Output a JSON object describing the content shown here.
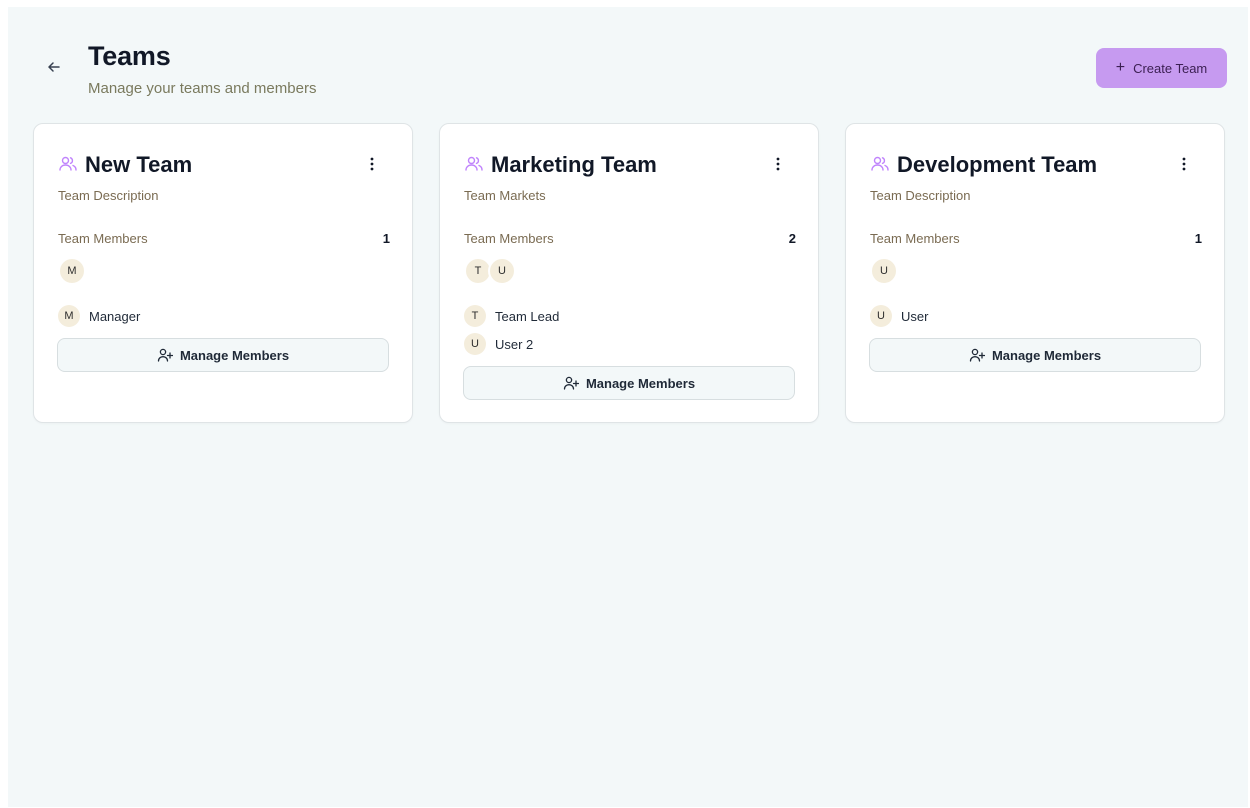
{
  "header": {
    "back_icon": "arrow-left-icon",
    "title": "Teams",
    "subtitle": "Manage your teams and members",
    "create_button": {
      "icon": "plus",
      "label": "Create Team"
    }
  },
  "colors": {
    "page_bg": "#f3f8f9",
    "accent": "#c69af0",
    "team_icon": "#c084fc",
    "avatar_bg": "#f4eddc",
    "muted_text": "#7a6b52"
  },
  "teams": [
    {
      "name": "New Team",
      "description": "Team Description",
      "members_label": "Team Members",
      "members_count": "1",
      "avatars": [
        "M"
      ],
      "members": [
        {
          "initial": "M",
          "name": "Manager"
        }
      ],
      "manage_label": "Manage Members"
    },
    {
      "name": "Marketing Team",
      "description": "Team Markets",
      "members_label": "Team Members",
      "members_count": "2",
      "avatars": [
        "T",
        "U"
      ],
      "members": [
        {
          "initial": "T",
          "name": "Team Lead"
        },
        {
          "initial": "U",
          "name": "User 2"
        }
      ],
      "manage_label": "Manage Members"
    },
    {
      "name": "Development Team",
      "description": "Team Description",
      "members_label": "Team Members",
      "members_count": "1",
      "avatars": [
        "U"
      ],
      "members": [
        {
          "initial": "U",
          "name": "User"
        }
      ],
      "manage_label": "Manage Members"
    }
  ]
}
